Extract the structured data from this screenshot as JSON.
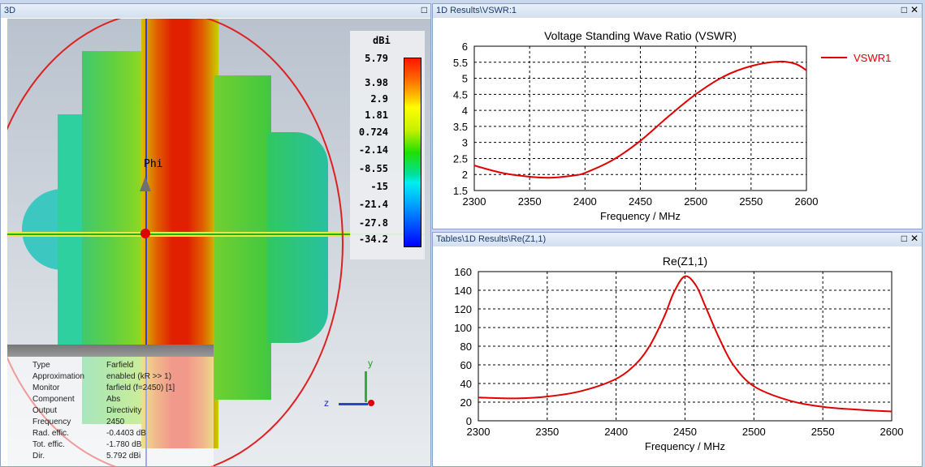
{
  "panels": {
    "left": {
      "title": "3D",
      "colorbar": {
        "unit": "dBi",
        "labels": [
          "5.79",
          "3.98",
          "2.9",
          "1.81",
          "0.724",
          "-2.14",
          "-8.55",
          "-15",
          "-21.4",
          "-27.8",
          "-34.2"
        ]
      },
      "axis_label": "Phi",
      "axes": {
        "y": "y",
        "z": "z"
      },
      "info": [
        [
          "Type",
          "Farfield"
        ],
        [
          "Approximation",
          "enabled (kR >> 1)"
        ],
        [
          "Monitor",
          "farfield (f=2450) [1]"
        ],
        [
          "Component",
          "Abs"
        ],
        [
          "Output",
          "Directivity"
        ],
        [
          "Frequency",
          "2450"
        ],
        [
          "Rad. effic.",
          "-0.4403 dB"
        ],
        [
          "Tot. effic.",
          "-1.780 dB"
        ],
        [
          "Dir.",
          "5.792 dBi"
        ]
      ]
    },
    "top_right": {
      "title": "1D Results\\VSWR:1"
    },
    "bottom_right": {
      "title": "Tables\\1D Results\\Re(Z1,1)"
    }
  },
  "buttons": {
    "maximize": "□",
    "close": "✕"
  },
  "chart_data": [
    {
      "type": "line",
      "title": "Voltage Standing Wave Ratio (VSWR)",
      "xlabel": "Frequency / MHz",
      "ylabel": "",
      "xlim": [
        2300,
        2600
      ],
      "ylim": [
        1.5,
        6
      ],
      "xticks": [
        2300,
        2350,
        2400,
        2450,
        2500,
        2550,
        2600
      ],
      "yticks": [
        1.5,
        2,
        2.5,
        3,
        3.5,
        4,
        4.5,
        5,
        5.5,
        6
      ],
      "grid": true,
      "legend": "top-right",
      "color": "#e00000",
      "series": [
        {
          "name": "VSWR1",
          "x": [
            2300,
            2325,
            2350,
            2370,
            2390,
            2400,
            2425,
            2450,
            2475,
            2500,
            2525,
            2550,
            2575,
            2590,
            2600
          ],
          "y": [
            2.28,
            2.05,
            1.93,
            1.9,
            1.97,
            2.05,
            2.45,
            3.05,
            3.8,
            4.5,
            5.05,
            5.38,
            5.52,
            5.45,
            5.25
          ]
        }
      ]
    },
    {
      "type": "line",
      "title": "Re(Z1,1)",
      "xlabel": "Frequency / MHz",
      "ylabel": "",
      "xlim": [
        2300,
        2600
      ],
      "ylim": [
        0,
        160
      ],
      "xticks": [
        2300,
        2350,
        2400,
        2450,
        2500,
        2550,
        2600
      ],
      "yticks": [
        0,
        20,
        40,
        60,
        80,
        100,
        120,
        140,
        160
      ],
      "grid": true,
      "color": "#e00000",
      "series": [
        {
          "name": "Re(Z1,1)",
          "x": [
            2300,
            2325,
            2350,
            2375,
            2400,
            2415,
            2425,
            2435,
            2442,
            2450,
            2458,
            2465,
            2475,
            2485,
            2500,
            2525,
            2550,
            2575,
            2600
          ],
          "y": [
            25,
            24,
            26,
            32,
            45,
            62,
            82,
            112,
            138,
            155,
            145,
            122,
            88,
            60,
            37,
            22,
            15,
            12,
            10
          ]
        }
      ]
    }
  ]
}
